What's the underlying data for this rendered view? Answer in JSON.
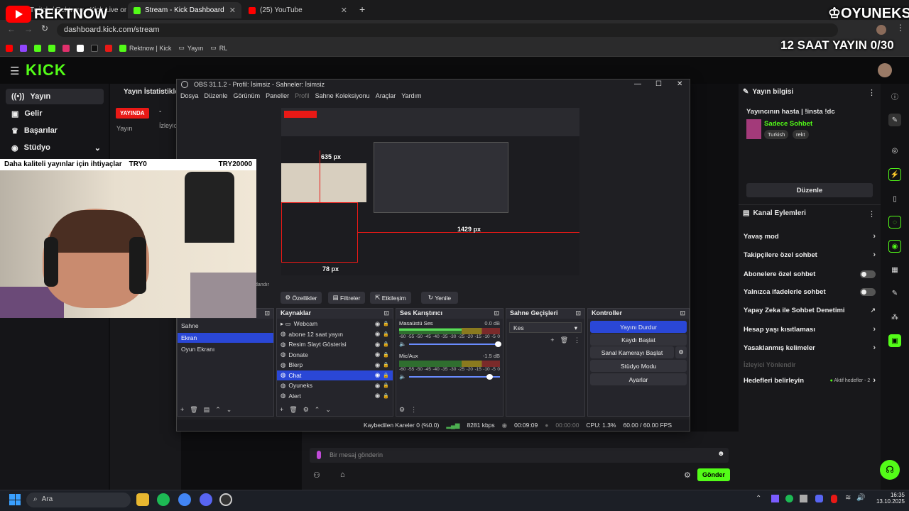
{
  "browser": {
    "tabs": [
      {
        "label": "Twitch / Rektnow - Kick Live on"
      },
      {
        "label": "Stream - Kick Dashboard"
      },
      {
        "label": "(25) YouTube"
      }
    ],
    "url": "dashboard.kick.com/stream",
    "bookmarks": [
      "Rektnow | Kick",
      "Yayın",
      "RL"
    ]
  },
  "overlay": {
    "brand_left": "REKTNOW",
    "brand_right": "OYUNEKS",
    "timer": "12 SAAT YAYIN 0/30",
    "ticker_left": "Daha kaliteli yayınlar için ihtiyaçlar",
    "ticker_mid": "TRY0",
    "ticker_right": "TRY20000"
  },
  "kick": {
    "logo": "KICK",
    "sidebar": [
      {
        "label": "Yayın",
        "icon": "broadcast-icon"
      },
      {
        "label": "Gelir",
        "icon": "money-icon"
      },
      {
        "label": "Başarılar",
        "icon": "trophy-icon"
      },
      {
        "label": "Stüdyo",
        "icon": "studio-icon"
      }
    ],
    "stats_title": "Yayın İstatistikleri",
    "live_badge": "YAYINDA",
    "stats_label": "Yayın",
    "viewer_label": "İzleyic",
    "stream_info": {
      "title": "Yayın bilgisi",
      "stream_title": "Yayıncının hasta | !insta !dc",
      "category": "Sadece Sohbet",
      "tags": [
        "Turkish",
        "rekt"
      ],
      "edit": "Düzenle"
    },
    "channel_actions": {
      "title": "Kanal Eylemleri",
      "items": [
        {
          "label": "Yavaş mod",
          "kind": "chevron"
        },
        {
          "label": "Takipçilere özel sohbet",
          "kind": "chevron"
        },
        {
          "label": "Abonelere özel sohbet",
          "kind": "toggle"
        },
        {
          "label": "Yalnızca ifadelerle sohbet",
          "kind": "toggle"
        },
        {
          "label": "Yapay Zeka ile Sohbet Denetimi",
          "kind": "external"
        },
        {
          "label": "Hesap yaşı kısıtlaması",
          "kind": "chevron"
        },
        {
          "label": "Yasaklanmış kelimeler",
          "kind": "chevron"
        }
      ],
      "redirect": "İzleyici Yönlendir",
      "goals": "Hedefleri belirleyin",
      "goals_status": "Aktif hedefler - 2"
    },
    "chat": {
      "placeholder": "Bir mesaj gönderin",
      "send": "Gönder"
    }
  },
  "obs": {
    "title": "OBS 31.1.2 - Profil: İsimsiz - Sahneler: İsimsiz",
    "menu": [
      "Dosya",
      "Düzenle",
      "Görünüm",
      "Paneller",
      "Profil",
      "Sahne Koleksiyonu",
      "Araçlar",
      "Yardım"
    ],
    "preview_labels": [
      "635 px",
      "1429 px",
      "78 px"
    ],
    "source_toolbar": [
      "Özellikler",
      "Filtreler",
      "Etkileşim",
      "Yenile"
    ],
    "toolbar_prefix": "dandır",
    "scenes": [
      "Sahne",
      "Ekran",
      "Oyun Ekranı"
    ],
    "selected_scene": 1,
    "sources_title": "Kaynaklar",
    "sources": [
      "Webcam",
      "abone 12 saat yayın",
      "Resim Slayt Gösterisi",
      "Donate",
      "Blerp",
      "Chat",
      "Oyuneks",
      "Alert"
    ],
    "selected_source": 5,
    "mixer_title": "Ses Karıştırıcı",
    "mixer": [
      {
        "name": "Masaüstü Ses",
        "db": "0.0 dB",
        "level": 0.62
      },
      {
        "name": "Mic/Aux",
        "db": "-1.5 dB",
        "level": 0.0
      }
    ],
    "mixer_scale": [
      "-60",
      "-55",
      "-50",
      "-45",
      "-40",
      "-35",
      "-30",
      "-25",
      "-20",
      "-15",
      "-10",
      "-5",
      "0"
    ],
    "transitions_title": "Sahne Geçişleri",
    "transition": "Kes",
    "controls_title": "Kontroller",
    "controls": [
      "Yayını Durdur",
      "Kaydı Başlat",
      "Sanal Kamerayı Başlat",
      "Stüdyo Modu",
      "Ayarlar"
    ],
    "status": {
      "dropped": "Kaybedilen Kareler 0 (%0.0)",
      "bitrate": "8281 kbps",
      "live_time": "00:09:09",
      "rec_time": "00:00:00",
      "cpu": "CPU: 1.3%",
      "fps": "60.00 / 60.00 FPS"
    }
  },
  "taskbar": {
    "search": "Ara",
    "time": "16:35",
    "date": "13.10.2025"
  },
  "colors": {
    "kick_green": "#53fc18",
    "obs_blue": "#2a47d6",
    "live_red": "#e91916"
  }
}
